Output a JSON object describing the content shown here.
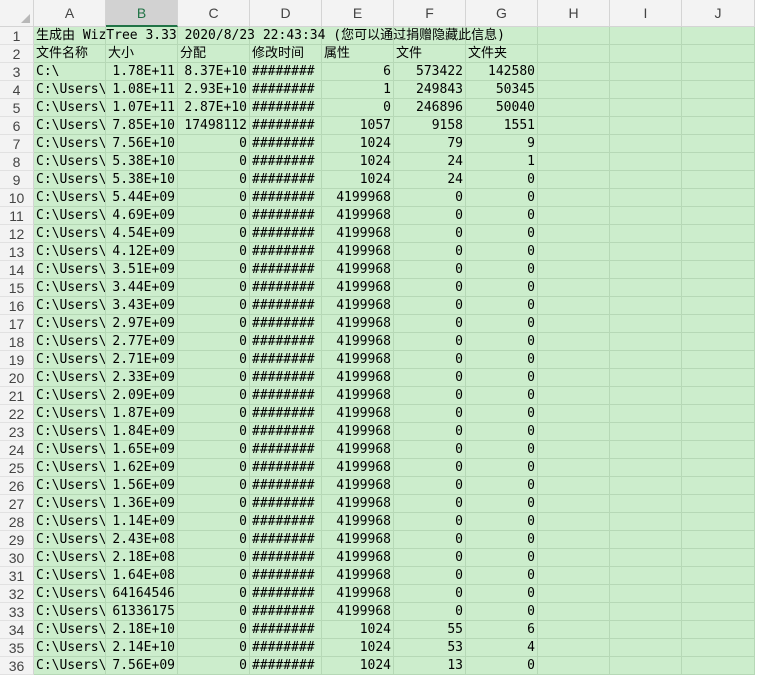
{
  "columns": [
    "A",
    "B",
    "C",
    "D",
    "E",
    "F",
    "G",
    "H",
    "I",
    "J"
  ],
  "selected_column": "B",
  "title_row": "生成由 WizTree 3.33 2020/8/23 22:43:34 (您可以通过捐赠隐藏此信息)",
  "header_row": [
    "文件名称",
    "大小",
    "分配",
    "修改时间",
    "属性",
    "文件",
    "文件夹"
  ],
  "rows": [
    [
      "C:\\",
      "1.78E+11",
      "8.37E+10",
      "########",
      "6",
      "573422",
      "142580"
    ],
    [
      "C:\\Users\\",
      "1.08E+11",
      "2.93E+10",
      "########",
      "1",
      "249843",
      "50345"
    ],
    [
      "C:\\Users\\",
      "1.07E+11",
      "2.87E+10",
      "########",
      "0",
      "246896",
      "50040"
    ],
    [
      "C:\\Users\\",
      "7.85E+10",
      "17498112",
      "########",
      "1057",
      "9158",
      "1551"
    ],
    [
      "C:\\Users\\",
      "7.56E+10",
      "0",
      "########",
      "1024",
      "79",
      "9"
    ],
    [
      "C:\\Users\\",
      "5.38E+10",
      "0",
      "########",
      "1024",
      "24",
      "1"
    ],
    [
      "C:\\Users\\",
      "5.38E+10",
      "0",
      "########",
      "1024",
      "24",
      "0"
    ],
    [
      "C:\\Users\\",
      "5.44E+09",
      "0",
      "########",
      "4199968",
      "0",
      "0"
    ],
    [
      "C:\\Users\\",
      "4.69E+09",
      "0",
      "########",
      "4199968",
      "0",
      "0"
    ],
    [
      "C:\\Users\\",
      "4.54E+09",
      "0",
      "########",
      "4199968",
      "0",
      "0"
    ],
    [
      "C:\\Users\\",
      "4.12E+09",
      "0",
      "########",
      "4199968",
      "0",
      "0"
    ],
    [
      "C:\\Users\\",
      "3.51E+09",
      "0",
      "########",
      "4199968",
      "0",
      "0"
    ],
    [
      "C:\\Users\\",
      "3.44E+09",
      "0",
      "########",
      "4199968",
      "0",
      "0"
    ],
    [
      "C:\\Users\\",
      "3.43E+09",
      "0",
      "########",
      "4199968",
      "0",
      "0"
    ],
    [
      "C:\\Users\\",
      "2.97E+09",
      "0",
      "########",
      "4199968",
      "0",
      "0"
    ],
    [
      "C:\\Users\\",
      "2.77E+09",
      "0",
      "########",
      "4199968",
      "0",
      "0"
    ],
    [
      "C:\\Users\\",
      "2.71E+09",
      "0",
      "########",
      "4199968",
      "0",
      "0"
    ],
    [
      "C:\\Users\\",
      "2.33E+09",
      "0",
      "########",
      "4199968",
      "0",
      "0"
    ],
    [
      "C:\\Users\\",
      "2.09E+09",
      "0",
      "########",
      "4199968",
      "0",
      "0"
    ],
    [
      "C:\\Users\\",
      "1.87E+09",
      "0",
      "########",
      "4199968",
      "0",
      "0"
    ],
    [
      "C:\\Users\\",
      "1.84E+09",
      "0",
      "########",
      "4199968",
      "0",
      "0"
    ],
    [
      "C:\\Users\\",
      "1.65E+09",
      "0",
      "########",
      "4199968",
      "0",
      "0"
    ],
    [
      "C:\\Users\\",
      "1.62E+09",
      "0",
      "########",
      "4199968",
      "0",
      "0"
    ],
    [
      "C:\\Users\\",
      "1.56E+09",
      "0",
      "########",
      "4199968",
      "0",
      "0"
    ],
    [
      "C:\\Users\\",
      "1.36E+09",
      "0",
      "########",
      "4199968",
      "0",
      "0"
    ],
    [
      "C:\\Users\\",
      "1.14E+09",
      "0",
      "########",
      "4199968",
      "0",
      "0"
    ],
    [
      "C:\\Users\\",
      "2.43E+08",
      "0",
      "########",
      "4199968",
      "0",
      "0"
    ],
    [
      "C:\\Users\\",
      "2.18E+08",
      "0",
      "########",
      "4199968",
      "0",
      "0"
    ],
    [
      "C:\\Users\\",
      "1.64E+08",
      "0",
      "########",
      "4199968",
      "0",
      "0"
    ],
    [
      "C:\\Users\\",
      "64164546",
      "0",
      "########",
      "4199968",
      "0",
      "0"
    ],
    [
      "C:\\Users\\",
      "61336175",
      "0",
      "########",
      "4199968",
      "0",
      "0"
    ],
    [
      "C:\\Users\\",
      "2.18E+10",
      "0",
      "########",
      "1024",
      "55",
      "6"
    ],
    [
      "C:\\Users\\",
      "2.14E+10",
      "0",
      "########",
      "1024",
      "53",
      "4"
    ],
    [
      "C:\\Users\\",
      "7.56E+09",
      "0",
      "########",
      "1024",
      "13",
      "0"
    ]
  ]
}
